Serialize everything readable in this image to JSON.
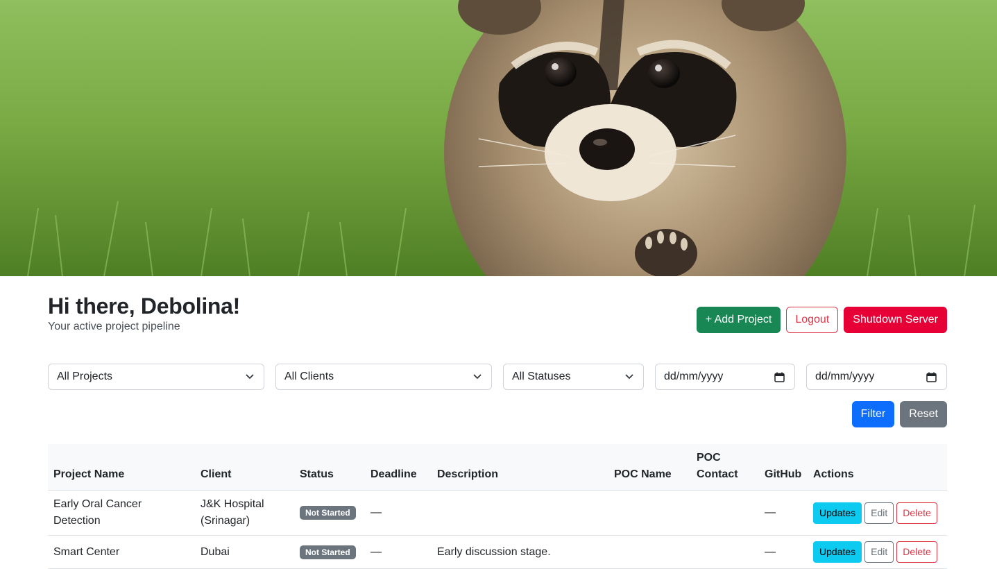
{
  "header": {
    "greeting": "Hi there, Debolina!",
    "subtitle": "Your active project pipeline",
    "add_project_label": "+ Add Project",
    "logout_label": "Logout",
    "shutdown_label": "Shutdown Server"
  },
  "filters": {
    "project_select": "All Projects",
    "client_select": "All Clients",
    "status_select": "All Statuses",
    "date_from_placeholder": "dd/mm/yyyy",
    "date_to_placeholder": "dd/mm/yyyy",
    "filter_label": "Filter",
    "reset_label": "Reset"
  },
  "table": {
    "columns": [
      "Project Name",
      "Client",
      "Status",
      "Deadline",
      "Description",
      "POC Name",
      "POC Contact",
      "GitHub",
      "Actions"
    ],
    "rows": [
      {
        "name": "Early Oral Cancer Detection",
        "client": "J&K Hospital (Srinagar)",
        "status": "Not Started",
        "deadline": "—",
        "description": "",
        "poc_name": "",
        "poc_contact": "",
        "github": "—",
        "actions": [
          "Updates",
          "Edit",
          "Delete"
        ]
      },
      {
        "name": "Smart Center",
        "client": "Dubai",
        "status": "Not Started",
        "deadline": "—",
        "description": "Early discussion stage.",
        "poc_name": "",
        "poc_contact": "",
        "github": "—",
        "actions": [
          "Updates",
          "Edit",
          "Delete"
        ]
      }
    ]
  },
  "colors": {
    "success": "#198754",
    "danger": "#dc3545",
    "shutdown": "#e60036",
    "primary": "#0d6efd",
    "secondary": "#6c757d",
    "info": "#0dcaf0",
    "badge": "#6c757d"
  },
  "icons": {
    "select_arrow": "chevron-down-icon",
    "date_picker": "calendar-icon"
  }
}
